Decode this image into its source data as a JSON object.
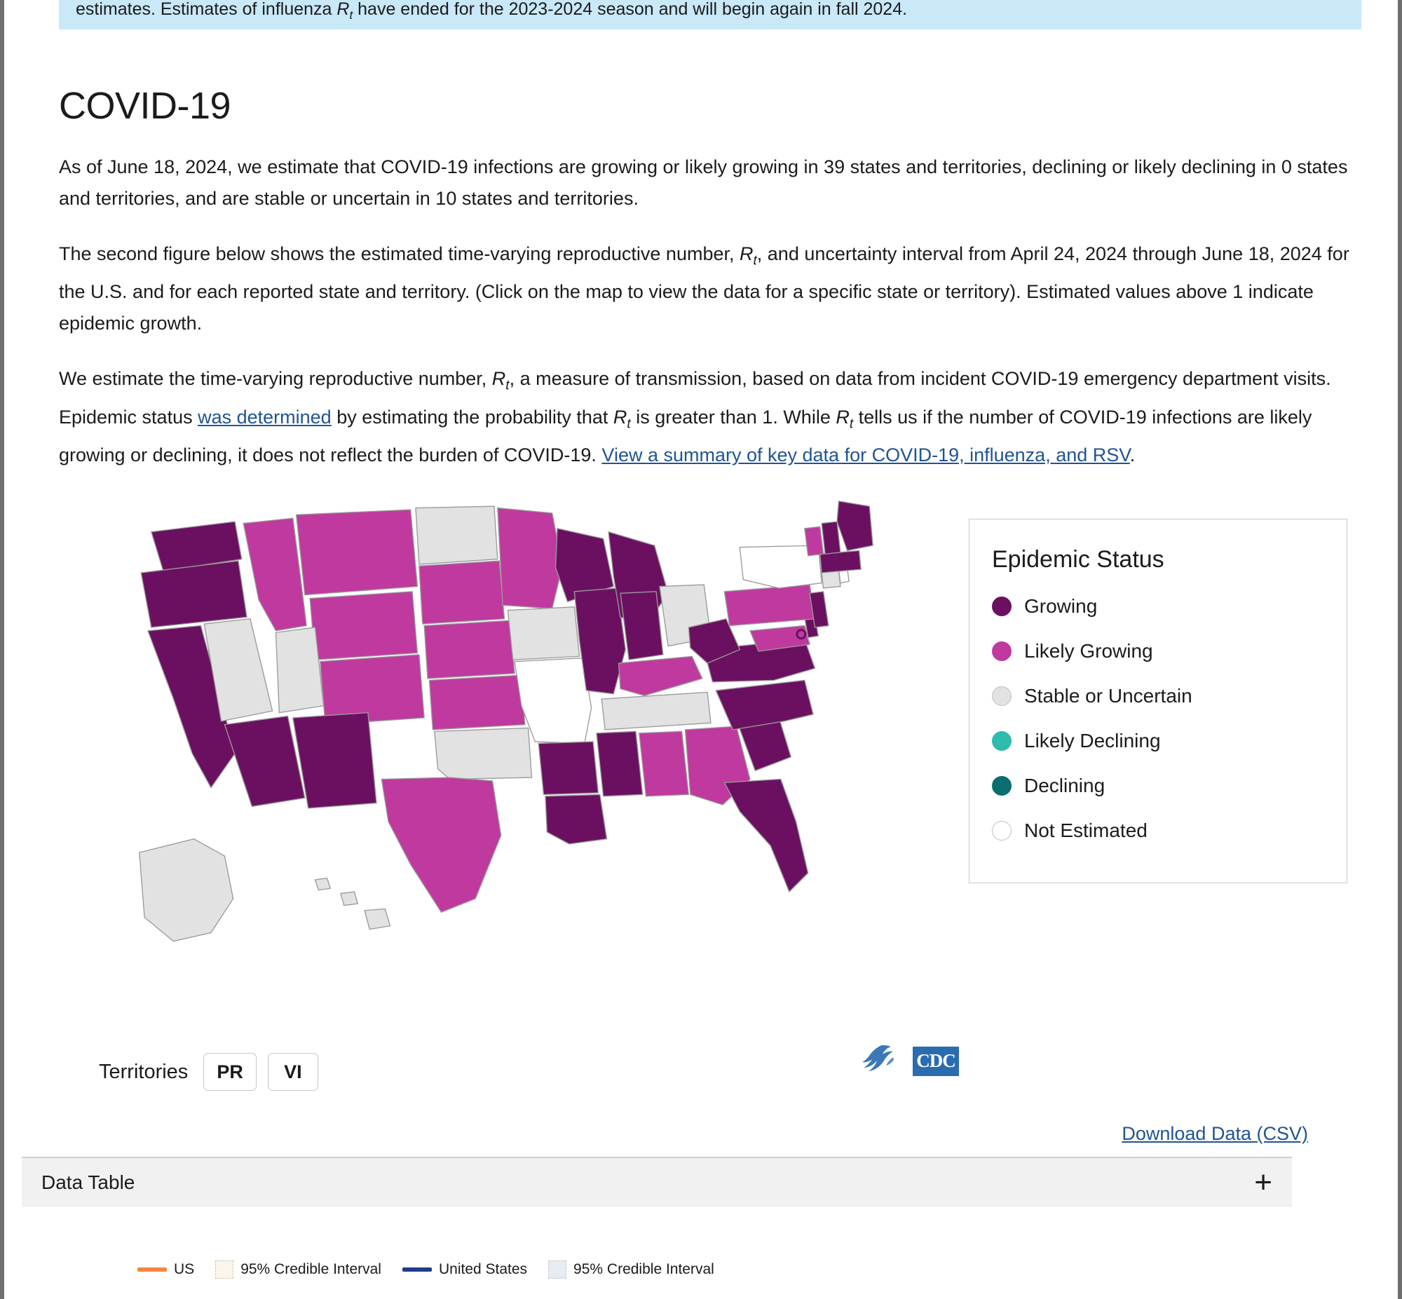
{
  "alert": {
    "text_prefix": "estimates. Estimates of influenza ",
    "rt_symbol": "R",
    "rt_sub": "t",
    "text_suffix": " have ended for the 2023-2024 season and will begin again in fall 2024.",
    "background_color": "#c9e8f8"
  },
  "section": {
    "title": "COVID-19",
    "paragraph_1": "As of June 18, 2024, we estimate that COVID-19 infections are growing or likely growing in 39 states and territories, declining or likely declining in 0 states and territories, and are stable or uncertain in 10 states and territories.",
    "paragraph_2_part_a": "The second figure below shows the estimated time-varying reproductive number, ",
    "paragraph_2_part_b": ", and uncertainty interval from April 24, 2024 through June 18, 2024 for the U.S. and for each reported state and territory. (Click on the map to view the data for a specific state or territory). Estimated values above 1 indicate epidemic growth.",
    "paragraph_3_part_a": "We estimate the time-varying reproductive number, ",
    "paragraph_3_part_b": ", a measure of transmission, based on data from incident COVID-19 emergency department visits. Epidemic status ",
    "link_was_determined": "was determined",
    "paragraph_3_part_c": " by estimating the probability that ",
    "paragraph_3_part_d": " is greater than 1. While ",
    "paragraph_3_part_e": " tells us if the number of COVID-19 infections are likely growing or declining, it does not reflect the burden of COVID-19. ",
    "link_view_summary": "View a summary of key data for COVID-19, influenza, and RSV",
    "paragraph_3_end": "."
  },
  "legend": {
    "title": "Epidemic Status",
    "items": [
      {
        "label": "Growing",
        "color": "#6B1060",
        "border": "#6B1060"
      },
      {
        "label": "Likely Growing",
        "color": "#C0399F",
        "border": "#C0399F"
      },
      {
        "label": "Stable or Uncertain",
        "color": "#E2E2E2",
        "border": "#c0c0c0"
      },
      {
        "label": "Likely Declining",
        "color": "#2DBCAD",
        "border": "#2DBCAD"
      },
      {
        "label": "Declining",
        "color": "#0A6E6E",
        "border": "#0A6E6E"
      },
      {
        "label": "Not Estimated",
        "color": "#FFFFFF",
        "border": "#c0c0c0"
      }
    ]
  },
  "territories": {
    "label": "Territories",
    "buttons": [
      "PR",
      "VI"
    ]
  },
  "logos": {
    "hhs_icon": "hhs-eagle-icon",
    "cdc_text": "CDC"
  },
  "download": {
    "label": "Download Data (CSV)"
  },
  "data_table": {
    "label": "Data Table",
    "expand_icon": "+"
  },
  "chart_legend": {
    "items": [
      {
        "type": "line",
        "label": "US",
        "color": "#F5863F"
      },
      {
        "type": "swatch",
        "label": "95% Credible Interval",
        "color": "#FDF6E8"
      },
      {
        "type": "line",
        "label": "United States",
        "color": "#1F3C88"
      },
      {
        "type": "swatch",
        "label": "95% Credible Interval",
        "color": "#E8EAF4"
      }
    ]
  },
  "chart_data": {
    "type": "choropleth",
    "title": "COVID-19 Epidemic Status by State and Territory",
    "as_of_date": "June 18, 2024",
    "categories": [
      "Growing",
      "Likely Growing",
      "Stable or Uncertain",
      "Likely Declining",
      "Declining",
      "Not Estimated"
    ],
    "category_colors": [
      "#6B1060",
      "#C0399F",
      "#E2E2E2",
      "#2DBCAD",
      "#0A6E6E",
      "#FFFFFF"
    ],
    "counts": {
      "growing_or_likely_growing": 39,
      "declining_or_likely_declining": 0,
      "stable_or_uncertain": 10
    },
    "states": {
      "WA": "Growing",
      "OR": "Growing",
      "CA": "Growing",
      "ID": "Likely Growing",
      "MT": "Likely Growing",
      "WY": "Likely Growing",
      "NV": "Stable or Uncertain",
      "UT": "Stable or Uncertain",
      "CO": "Likely Growing",
      "AZ": "Growing",
      "NM": "Growing",
      "ND": "Stable or Uncertain",
      "SD": "Likely Growing",
      "NE": "Likely Growing",
      "KS": "Likely Growing",
      "OK": "Stable or Uncertain",
      "TX": "Likely Growing",
      "MN": "Likely Growing",
      "IA": "Stable or Uncertain",
      "MO": "Not Estimated",
      "AR": "Growing",
      "LA": "Growing",
      "WI": "Growing",
      "IL": "Growing",
      "MI": "Growing",
      "IN": "Growing",
      "OH": "Stable or Uncertain",
      "KY": "Likely Growing",
      "TN": "Stable or Uncertain",
      "MS": "Growing",
      "AL": "Likely Growing",
      "GA": "Likely Growing",
      "FL": "Growing",
      "SC": "Growing",
      "NC": "Growing",
      "VA": "Growing",
      "WV": "Growing",
      "MD": "Likely Growing",
      "DE": "Growing",
      "PA": "Likely Growing",
      "NJ": "Growing",
      "NY": "Not Estimated",
      "CT": "Stable or Uncertain",
      "RI": "Not Estimated",
      "MA": "Growing",
      "VT": "Likely Growing",
      "NH": "Growing",
      "ME": "Growing",
      "AK": "Stable or Uncertain",
      "HI": "Stable or Uncertain",
      "DC": "Growing"
    }
  }
}
